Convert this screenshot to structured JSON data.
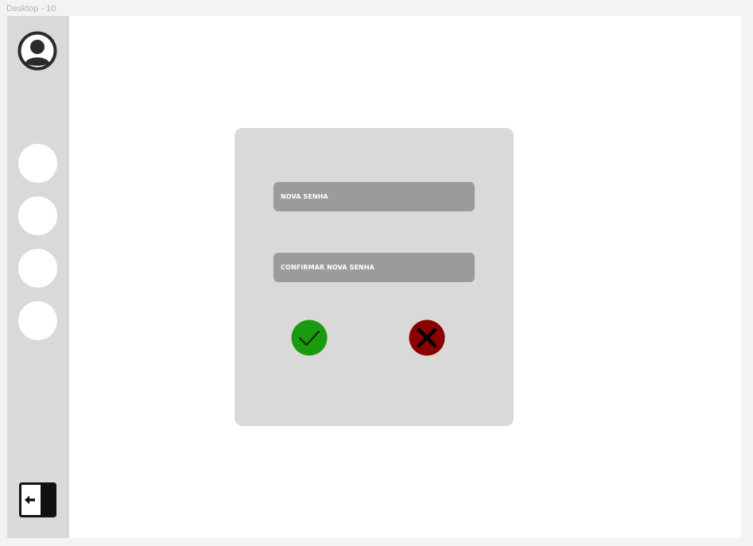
{
  "frame": {
    "label": "Desktop - 10"
  },
  "sidebar": {
    "items": [
      {
        "name": "nav-item-1"
      },
      {
        "name": "nav-item-2"
      },
      {
        "name": "nav-item-3"
      },
      {
        "name": "nav-item-4"
      }
    ],
    "icons": {
      "profile": "user-circle-icon",
      "logout": "logout-arrow-icon"
    }
  },
  "modal": {
    "new_password_label": "NOVA SENHA",
    "confirm_password_label": "CONFIRMAR NOVA SENHA",
    "confirm_icon": "check-icon",
    "cancel_icon": "x-icon"
  },
  "colors": {
    "background": "#f3f3f3",
    "sidebar": "#d9d9d9",
    "modal": "#d9d9d9",
    "field": "#9b9b9b",
    "confirm": "#1a9a0f",
    "cancel": "#8b0000"
  }
}
